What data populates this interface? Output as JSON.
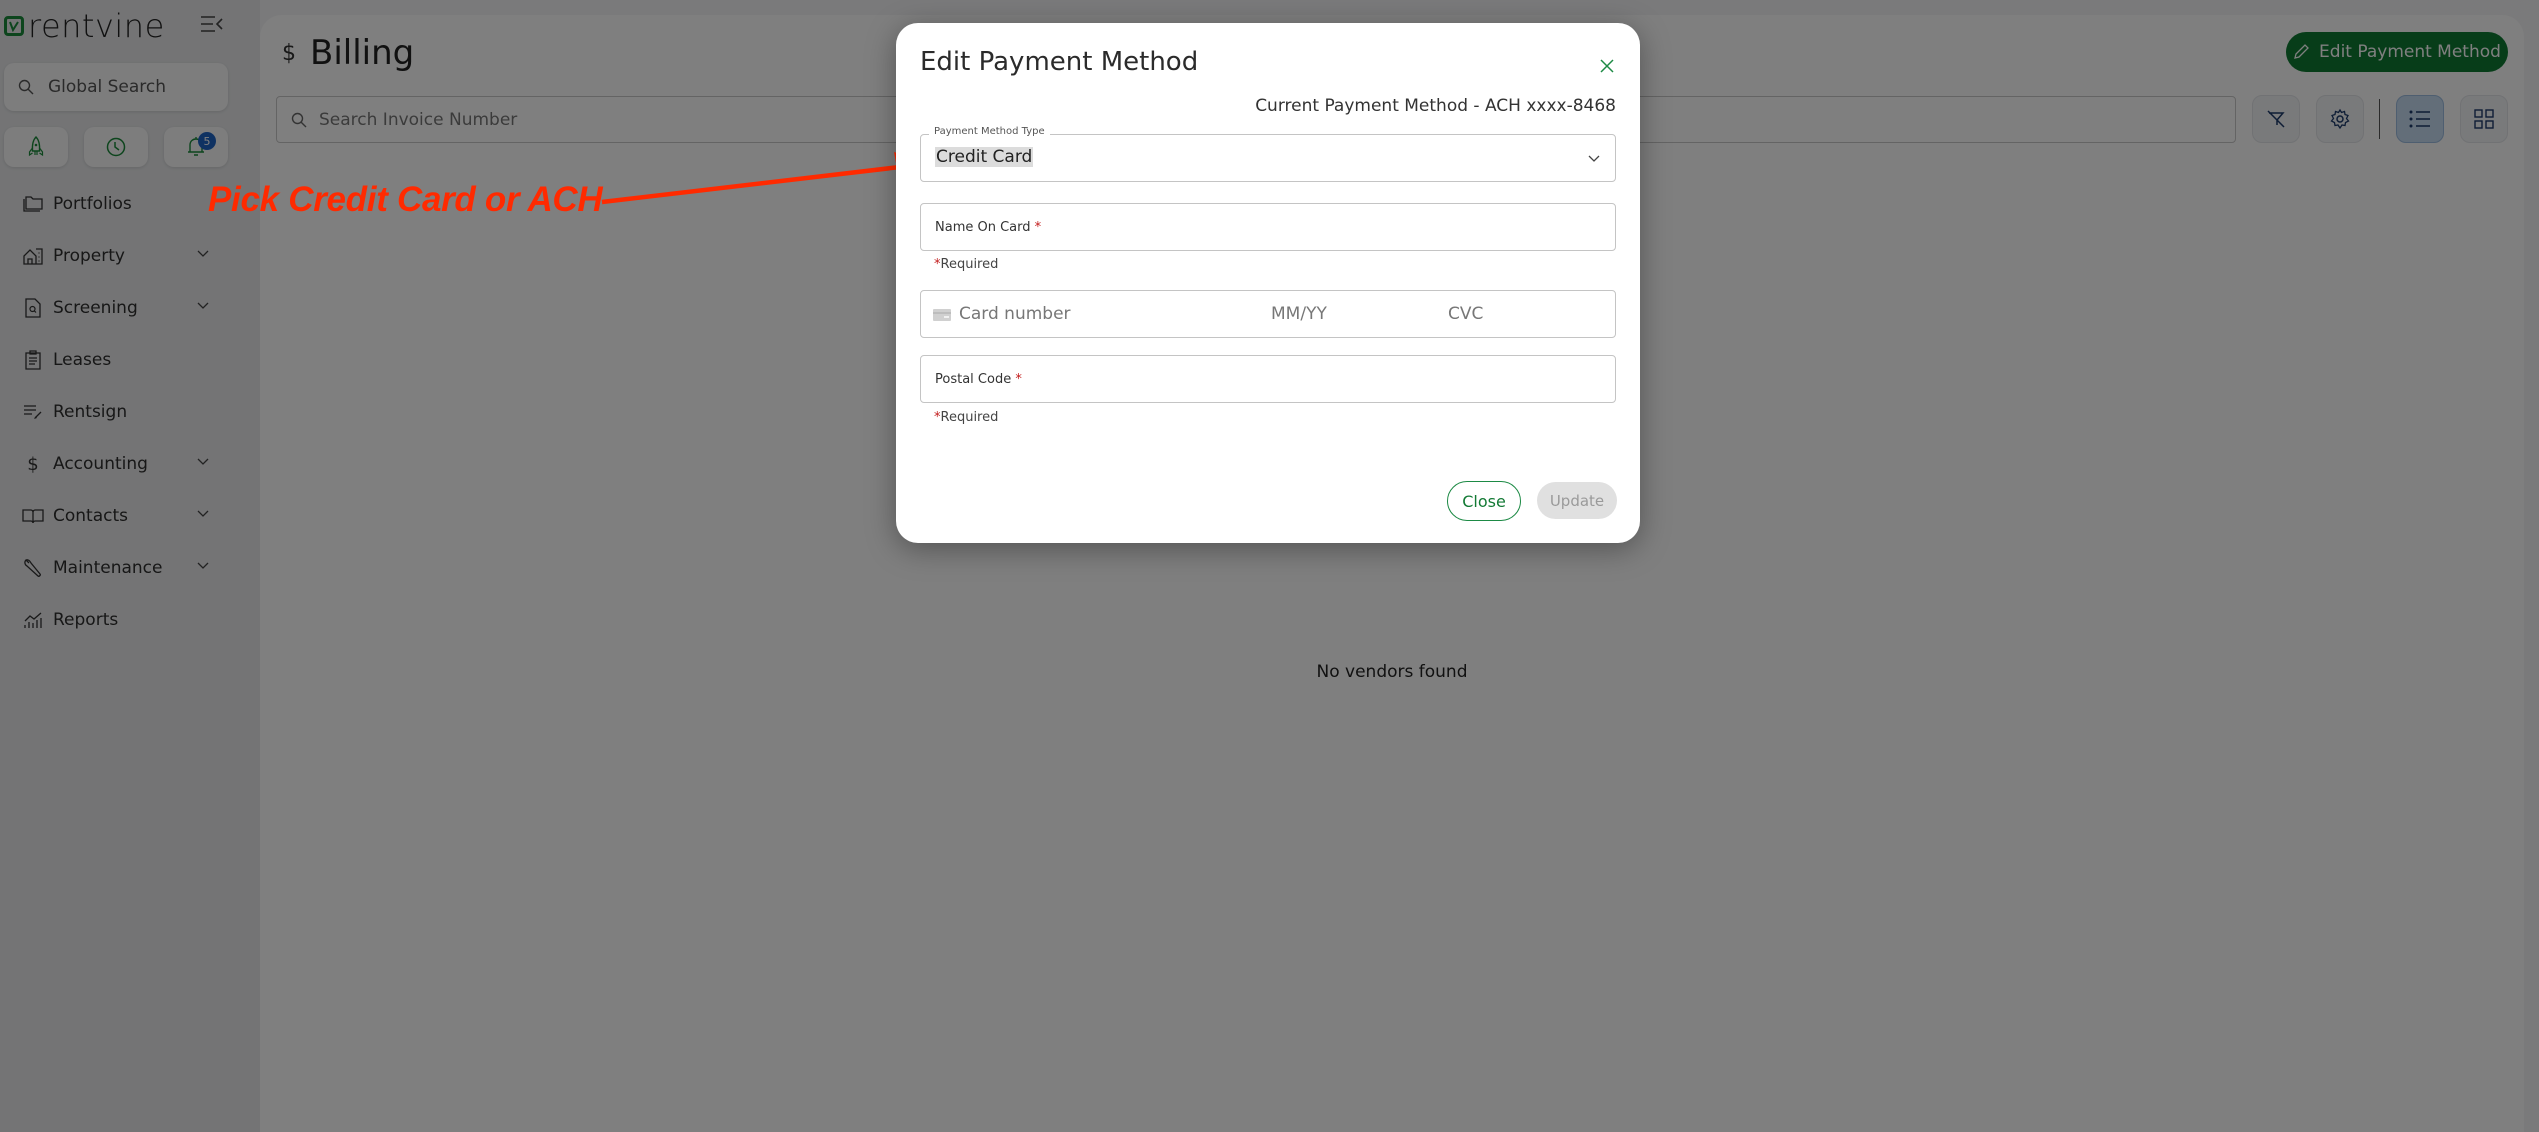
{
  "app": {
    "brand": "rentvine",
    "brand_color": "#1b8a3a",
    "accent_color": "#0e7a33"
  },
  "sidebar": {
    "global_search_placeholder": "Global Search",
    "quick_buttons": [
      {
        "icon": "rocket-icon"
      },
      {
        "icon": "clock-icon"
      },
      {
        "icon": "bell-icon",
        "badge": "5"
      }
    ],
    "items": [
      {
        "label": "Portfolios",
        "icon": "folder-icon",
        "expandable": false
      },
      {
        "label": "Property",
        "icon": "house-icon",
        "expandable": true
      },
      {
        "label": "Screening",
        "icon": "document-search-icon",
        "expandable": true
      },
      {
        "label": "Leases",
        "icon": "clipboard-icon",
        "expandable": false
      },
      {
        "label": "Rentsign",
        "icon": "sign-pen-icon",
        "expandable": false
      },
      {
        "label": "Accounting",
        "icon": "dollar-icon",
        "expandable": true
      },
      {
        "label": "Contacts",
        "icon": "book-icon",
        "expandable": true
      },
      {
        "label": "Maintenance",
        "icon": "wrench-icon",
        "expandable": true
      },
      {
        "label": "Reports",
        "icon": "chart-icon",
        "expandable": false
      }
    ]
  },
  "page": {
    "title_icon": "$",
    "title": "Billing",
    "edit_payment_method_label": "Edit Payment Method",
    "search_placeholder": "Search Invoice Number",
    "empty_message": "No vendors found",
    "toolbar": {
      "clear_filter": "clear-filter-icon",
      "settings": "gear-icon",
      "list_view_active": true,
      "grid_view_active": false
    }
  },
  "annotation": {
    "text": "Pick Credit Card or ACH",
    "color": "#ff2a00"
  },
  "modal": {
    "title": "Edit Payment Method",
    "current_payment_method": "Current Payment Method - ACH xxxx-8468",
    "payment_method_type": {
      "label": "Payment Method Type",
      "value": "Credit Card"
    },
    "name_on_card": {
      "label": "Name On Card",
      "required_mark": "*",
      "value": "",
      "helper_star": "*",
      "helper": "Required"
    },
    "card": {
      "number_placeholder": "Card number",
      "expiry_placeholder": "MM/YY",
      "cvc_placeholder": "CVC"
    },
    "postal_code": {
      "label": "Postal Code",
      "required_mark": "*",
      "value": "",
      "helper_star": "*",
      "helper": "Required"
    },
    "buttons": {
      "close": "Close",
      "update": "Update",
      "update_disabled": true
    }
  }
}
